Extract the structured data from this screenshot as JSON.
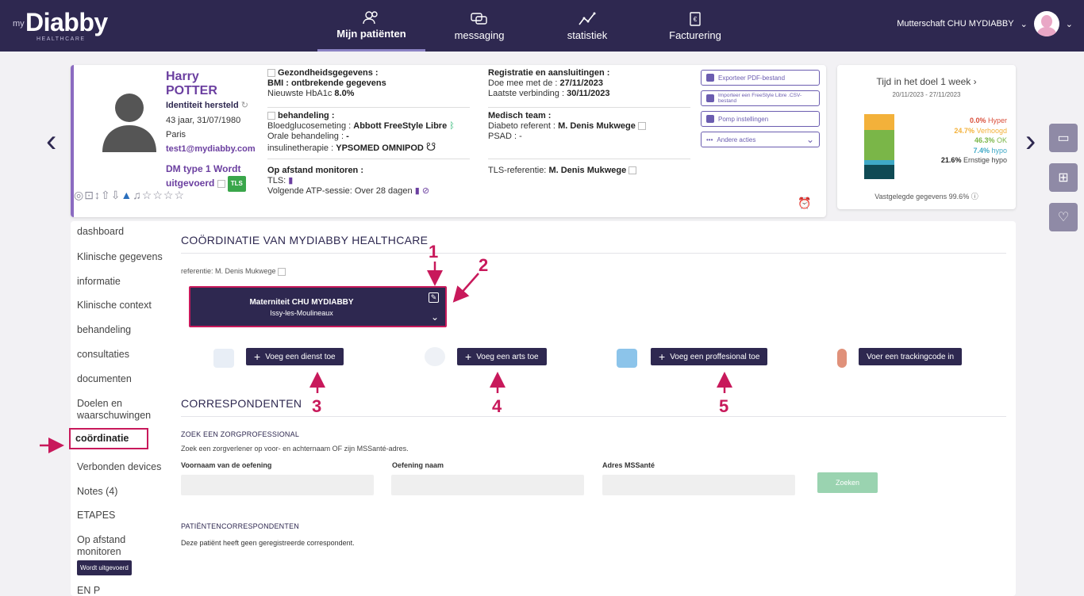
{
  "brand": {
    "my": "my",
    "name": "Diabby",
    "sub": "HEALTHCARE"
  },
  "nav": [
    {
      "label": "Mijn patiënten",
      "icon": "patients-icon",
      "active": true
    },
    {
      "label": "messaging",
      "icon": "chat-icon",
      "active": false
    },
    {
      "label": "statistiek",
      "icon": "stats-icon",
      "active": false
    },
    {
      "label": "Facturering",
      "icon": "invoice-icon",
      "active": false
    }
  ],
  "user": {
    "name": "Mutterschaft CHU MYDIABBY"
  },
  "patient": {
    "first_name": "Harry",
    "last_name": "POTTER",
    "identity": "Identiteit hersteld",
    "age_dob": "43 jaar, 31/07/1980",
    "city": "Paris",
    "email": "test1@mydiabby.com",
    "diabetes_line1": "DM type 1  Wordt",
    "diabetes_line2": "uitgevoerd",
    "tls_badge": "TLS"
  },
  "health": {
    "title": "Gezondheidsgegevens :",
    "bmi": "BMI : ontbrekende gegevens",
    "hba1c_label": "Nieuwste HbA1c",
    "hba1c_value": "8.0%"
  },
  "treatment": {
    "title": "behandeling :",
    "glucose_label": "Bloedglucosemeting :",
    "glucose_value": "Abbott FreeStyle Libre",
    "oral_label": "Orale behandeling :",
    "oral_value": "-",
    "insulin_label": "insulinetherapie :",
    "insulin_value": "YPSOMED OMNIPOD"
  },
  "remote": {
    "title": "Op afstand monitoren :",
    "tls": "TLS:",
    "atp": "Volgende ATP-sessie: Over 28 dagen"
  },
  "registration": {
    "title": "Registratie en aansluitingen :",
    "joined_label": "Doe mee met de :",
    "joined_value": "27/11/2023",
    "last_label": "Laatste verbinding :",
    "last_value": "30/11/2023"
  },
  "team": {
    "title": "Medisch team :",
    "ref_label": "Diabeto referent :",
    "ref_value": "M. Denis Mukwege",
    "psad": "PSAD : -",
    "tls_ref_label": "TLS-referentie:",
    "tls_ref_value": "M. Denis Mukwege"
  },
  "actions": [
    {
      "label": "Exporteer PDF-bestand"
    },
    {
      "label": "Importeer een FreeStyle Libre .CSV-bestand"
    },
    {
      "label": "Pomp instellingen"
    },
    {
      "label": "Andere acties"
    }
  ],
  "tir": {
    "title": "Tijd in het doel 1 week",
    "date": "20/11/2023 - 27/11/2023",
    "segments": [
      {
        "label": "Hyper",
        "value": "0.0%",
        "pct": 0.0,
        "color": "#d94f3b"
      },
      {
        "label": "Verhoogd",
        "value": "24.7%",
        "pct": 24.7,
        "color": "#f3b13a"
      },
      {
        "label": "OK",
        "value": "46.3%",
        "pct": 46.3,
        "color": "#7ab648"
      },
      {
        "label": "hypo",
        "value": "7.4%",
        "pct": 7.4,
        "color": "#3fa9c6"
      },
      {
        "label": "Ernstige hypo",
        "value": "21.6%",
        "pct": 21.6,
        "color": "#0f4a54"
      }
    ],
    "footer": "Vastgelegde gegevens 99.6%"
  },
  "sidebar": [
    {
      "label": "dashboard"
    },
    {
      "label": "Klinische gegevens"
    },
    {
      "label": "informatie"
    },
    {
      "label": "Klinische context"
    },
    {
      "label": "behandeling"
    },
    {
      "label": "consultaties"
    },
    {
      "label": "documenten"
    },
    {
      "label": "Doelen en waarschuwingen"
    },
    {
      "label": "coördinatie"
    },
    {
      "label": "Verbonden devices"
    },
    {
      "label": "Notes (4)"
    },
    {
      "label": "ETAPES"
    },
    {
      "label": "Op afstand monitoren",
      "badge": "Wordt uitgevoerd"
    },
    {
      "label": "EN P"
    }
  ],
  "coordination": {
    "title": "COÖRDINATIE VAN MYDIABBY HEALTHCARE",
    "reference": "referentie: M. Denis Mukwege",
    "org_name": "Materniteit CHU MYDIABBY",
    "org_city": "Issy-les-Moulineaux",
    "add_service": "Voeg een dienst toe",
    "add_doctor": "Voeg een arts toe",
    "add_professional": "Voeg een proffesional toe",
    "tracking": "Voer een trackingcode in"
  },
  "correspondents": {
    "title": "CORRESPONDENTEN",
    "search_title": "ZOEK EEN ZORGPROFESSIONAL",
    "search_hint": "Zoek een zorgverlener op voor- en achternaam OF zijn MSSanté-adres.",
    "first_name_label": "Voornaam van de oefening",
    "last_name_label": "Oefening naam",
    "address_label": "Adres MSSanté",
    "search_button": "Zoeken",
    "patient_corr_title": "PATIËNTENCORRESPONDENTEN",
    "none": "Deze patiënt heeft geen geregistreerde correspondent."
  },
  "annotations": [
    "1",
    "2",
    "3",
    "4",
    "5"
  ]
}
